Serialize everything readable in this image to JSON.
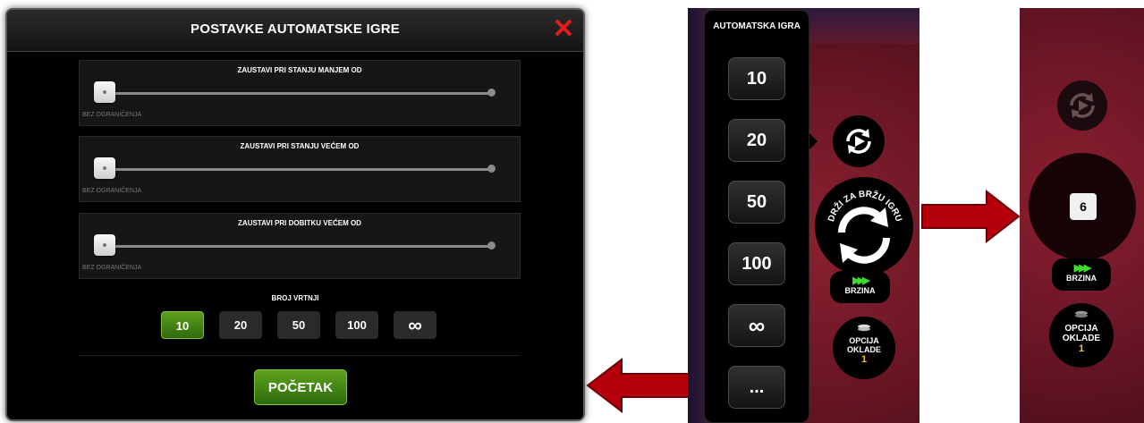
{
  "dialog": {
    "title": "POSTAVKE AUTOMATSKE IGRE",
    "close_icon": "close-x-icon",
    "sliders": [
      {
        "label": "ZAUSTAVI PRI STANJU MANJEM OD",
        "value_label": "BEZ OGRANIČENJA",
        "level": 0
      },
      {
        "label": "ZAUSTAVI PRI STANJU VEĆEM OD",
        "value_label": "BEZ OGRANIČENJA",
        "level": 0
      },
      {
        "label": "ZAUSTAVI PRI DOBITKU VEĆEM OD",
        "value_label": "BEZ OGRANIČENJA",
        "level": 0
      }
    ],
    "spins_label": "BROJ VRTNJI",
    "spin_options": [
      "10",
      "20",
      "50",
      "100",
      "∞"
    ],
    "selected_spin": "10",
    "start_label": "POČETAK"
  },
  "middle": {
    "title": "AUTOMATSKA IGRA",
    "options": [
      "10",
      "20",
      "50",
      "100",
      "∞",
      "..."
    ],
    "spin_button_text": "DRŽI ZA BRŽU IGRU",
    "speed_label": "BRZINA",
    "bet_label_1": "OPCIJA",
    "bet_label_2": "OKLADE",
    "bet_value": "1"
  },
  "right": {
    "counter": "6",
    "speed_label": "BRZINA",
    "bet_label_1": "OPCIJA",
    "bet_label_2": "OKLADE",
    "bet_value": "1"
  },
  "colors": {
    "accent_green": "#5fa21f",
    "close_red": "#e21b1b",
    "arrow_red": "#b5000b",
    "bet_yellow": "#f4c430",
    "speed_green": "#3fdc2f"
  }
}
